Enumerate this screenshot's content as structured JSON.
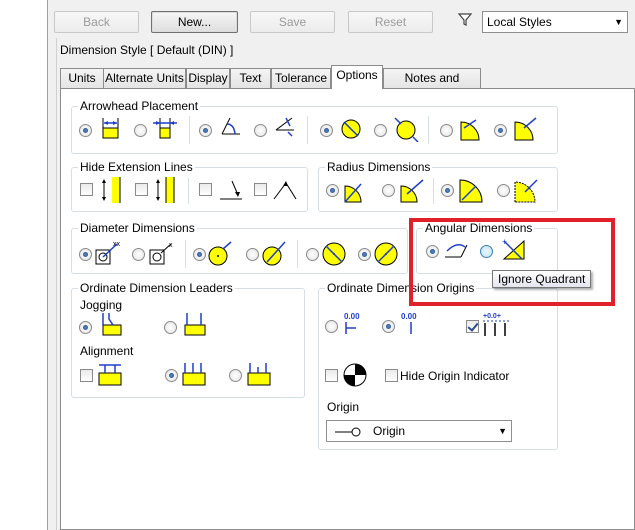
{
  "toolbar": {
    "back_label": "Back",
    "new_label": "New...",
    "save_label": "Save",
    "reset_label": "Reset",
    "filter_icon": "filter-icon",
    "styles_select": "Local Styles"
  },
  "dialog": {
    "style_title": "Dimension Style [ Default (DIN) ]"
  },
  "tabs": [
    {
      "label": "Units"
    },
    {
      "label": "Alternate Units"
    },
    {
      "label": "Display"
    },
    {
      "label": "Text"
    },
    {
      "label": "Tolerance"
    },
    {
      "label": "Options",
      "active": true
    },
    {
      "label": "Notes and Leaders"
    }
  ],
  "groups": {
    "arrowhead": {
      "title": "Arrowhead Placement"
    },
    "hide_ext": {
      "title": "Hide Extension Lines"
    },
    "radius": {
      "title": "Radius Dimensions"
    },
    "diameter": {
      "title": "Diameter Dimensions"
    },
    "angular": {
      "title": "Angular Dimensions"
    },
    "ordinate_leaders": {
      "title": "Ordinate Dimension Leaders",
      "jogging": "Jogging",
      "alignment": "Alignment"
    },
    "ordinate_origins": {
      "title": "Ordinate Dimension Origins",
      "hide_origin": "Hide Origin Indicator",
      "origin_label": "Origin",
      "origin_value": "Origin",
      "zero_label": "0.00"
    }
  },
  "tooltip": "Ignore Quadrant",
  "colors": {
    "accent_yellow": "#ffff00",
    "dimension_blue": "#1f3fc8",
    "highlight_red": "#e0202a"
  }
}
